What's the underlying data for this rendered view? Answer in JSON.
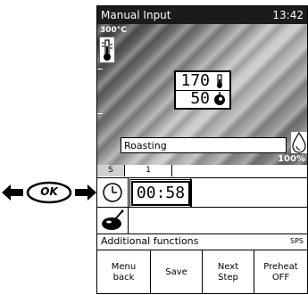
{
  "header": {
    "mode_title": "Manual Input",
    "time": "13:42"
  },
  "cavity": {
    "temp_scale_max": "300°C",
    "set_temperature": "170",
    "set_core_value": "50",
    "program_name": "Roasting",
    "humidity_percent": "100%"
  },
  "steps": {
    "tab_s_label": "S",
    "tab_1_label": "1"
  },
  "timer": {
    "value": "00:58"
  },
  "additional": {
    "label": "Additional functions",
    "code": "SPS"
  },
  "softkeys": {
    "menu_back": "Menu\nback",
    "save": "Save",
    "next_step": "Next\nStep",
    "preheat": "Preheat\nOFF"
  },
  "nav": {
    "ok_label": "OK"
  }
}
